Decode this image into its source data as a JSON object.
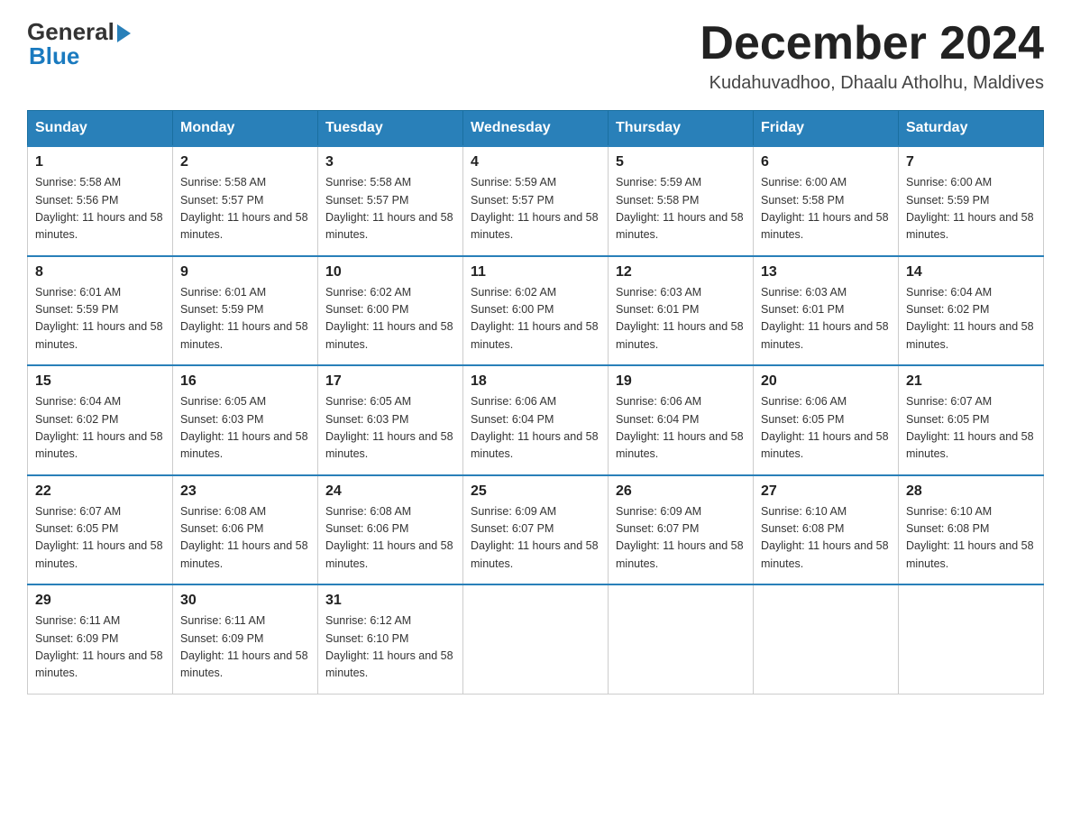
{
  "logo": {
    "general": "General",
    "arrow": "▶",
    "blue": "Blue"
  },
  "title": {
    "month_year": "December 2024",
    "location": "Kudahuvadhoo, Dhaalu Atholhu, Maldives"
  },
  "headers": [
    "Sunday",
    "Monday",
    "Tuesday",
    "Wednesday",
    "Thursday",
    "Friday",
    "Saturday"
  ],
  "weeks": [
    [
      {
        "day": "1",
        "sunrise": "Sunrise: 5:58 AM",
        "sunset": "Sunset: 5:56 PM",
        "daylight": "Daylight: 11 hours and 58 minutes."
      },
      {
        "day": "2",
        "sunrise": "Sunrise: 5:58 AM",
        "sunset": "Sunset: 5:57 PM",
        "daylight": "Daylight: 11 hours and 58 minutes."
      },
      {
        "day": "3",
        "sunrise": "Sunrise: 5:58 AM",
        "sunset": "Sunset: 5:57 PM",
        "daylight": "Daylight: 11 hours and 58 minutes."
      },
      {
        "day": "4",
        "sunrise": "Sunrise: 5:59 AM",
        "sunset": "Sunset: 5:57 PM",
        "daylight": "Daylight: 11 hours and 58 minutes."
      },
      {
        "day": "5",
        "sunrise": "Sunrise: 5:59 AM",
        "sunset": "Sunset: 5:58 PM",
        "daylight": "Daylight: 11 hours and 58 minutes."
      },
      {
        "day": "6",
        "sunrise": "Sunrise: 6:00 AM",
        "sunset": "Sunset: 5:58 PM",
        "daylight": "Daylight: 11 hours and 58 minutes."
      },
      {
        "day": "7",
        "sunrise": "Sunrise: 6:00 AM",
        "sunset": "Sunset: 5:59 PM",
        "daylight": "Daylight: 11 hours and 58 minutes."
      }
    ],
    [
      {
        "day": "8",
        "sunrise": "Sunrise: 6:01 AM",
        "sunset": "Sunset: 5:59 PM",
        "daylight": "Daylight: 11 hours and 58 minutes."
      },
      {
        "day": "9",
        "sunrise": "Sunrise: 6:01 AM",
        "sunset": "Sunset: 5:59 PM",
        "daylight": "Daylight: 11 hours and 58 minutes."
      },
      {
        "day": "10",
        "sunrise": "Sunrise: 6:02 AM",
        "sunset": "Sunset: 6:00 PM",
        "daylight": "Daylight: 11 hours and 58 minutes."
      },
      {
        "day": "11",
        "sunrise": "Sunrise: 6:02 AM",
        "sunset": "Sunset: 6:00 PM",
        "daylight": "Daylight: 11 hours and 58 minutes."
      },
      {
        "day": "12",
        "sunrise": "Sunrise: 6:03 AM",
        "sunset": "Sunset: 6:01 PM",
        "daylight": "Daylight: 11 hours and 58 minutes."
      },
      {
        "day": "13",
        "sunrise": "Sunrise: 6:03 AM",
        "sunset": "Sunset: 6:01 PM",
        "daylight": "Daylight: 11 hours and 58 minutes."
      },
      {
        "day": "14",
        "sunrise": "Sunrise: 6:04 AM",
        "sunset": "Sunset: 6:02 PM",
        "daylight": "Daylight: 11 hours and 58 minutes."
      }
    ],
    [
      {
        "day": "15",
        "sunrise": "Sunrise: 6:04 AM",
        "sunset": "Sunset: 6:02 PM",
        "daylight": "Daylight: 11 hours and 58 minutes."
      },
      {
        "day": "16",
        "sunrise": "Sunrise: 6:05 AM",
        "sunset": "Sunset: 6:03 PM",
        "daylight": "Daylight: 11 hours and 58 minutes."
      },
      {
        "day": "17",
        "sunrise": "Sunrise: 6:05 AM",
        "sunset": "Sunset: 6:03 PM",
        "daylight": "Daylight: 11 hours and 58 minutes."
      },
      {
        "day": "18",
        "sunrise": "Sunrise: 6:06 AM",
        "sunset": "Sunset: 6:04 PM",
        "daylight": "Daylight: 11 hours and 58 minutes."
      },
      {
        "day": "19",
        "sunrise": "Sunrise: 6:06 AM",
        "sunset": "Sunset: 6:04 PM",
        "daylight": "Daylight: 11 hours and 58 minutes."
      },
      {
        "day": "20",
        "sunrise": "Sunrise: 6:06 AM",
        "sunset": "Sunset: 6:05 PM",
        "daylight": "Daylight: 11 hours and 58 minutes."
      },
      {
        "day": "21",
        "sunrise": "Sunrise: 6:07 AM",
        "sunset": "Sunset: 6:05 PM",
        "daylight": "Daylight: 11 hours and 58 minutes."
      }
    ],
    [
      {
        "day": "22",
        "sunrise": "Sunrise: 6:07 AM",
        "sunset": "Sunset: 6:05 PM",
        "daylight": "Daylight: 11 hours and 58 minutes."
      },
      {
        "day": "23",
        "sunrise": "Sunrise: 6:08 AM",
        "sunset": "Sunset: 6:06 PM",
        "daylight": "Daylight: 11 hours and 58 minutes."
      },
      {
        "day": "24",
        "sunrise": "Sunrise: 6:08 AM",
        "sunset": "Sunset: 6:06 PM",
        "daylight": "Daylight: 11 hours and 58 minutes."
      },
      {
        "day": "25",
        "sunrise": "Sunrise: 6:09 AM",
        "sunset": "Sunset: 6:07 PM",
        "daylight": "Daylight: 11 hours and 58 minutes."
      },
      {
        "day": "26",
        "sunrise": "Sunrise: 6:09 AM",
        "sunset": "Sunset: 6:07 PM",
        "daylight": "Daylight: 11 hours and 58 minutes."
      },
      {
        "day": "27",
        "sunrise": "Sunrise: 6:10 AM",
        "sunset": "Sunset: 6:08 PM",
        "daylight": "Daylight: 11 hours and 58 minutes."
      },
      {
        "day": "28",
        "sunrise": "Sunrise: 6:10 AM",
        "sunset": "Sunset: 6:08 PM",
        "daylight": "Daylight: 11 hours and 58 minutes."
      }
    ],
    [
      {
        "day": "29",
        "sunrise": "Sunrise: 6:11 AM",
        "sunset": "Sunset: 6:09 PM",
        "daylight": "Daylight: 11 hours and 58 minutes."
      },
      {
        "day": "30",
        "sunrise": "Sunrise: 6:11 AM",
        "sunset": "Sunset: 6:09 PM",
        "daylight": "Daylight: 11 hours and 58 minutes."
      },
      {
        "day": "31",
        "sunrise": "Sunrise: 6:12 AM",
        "sunset": "Sunset: 6:10 PM",
        "daylight": "Daylight: 11 hours and 58 minutes."
      },
      null,
      null,
      null,
      null
    ]
  ]
}
